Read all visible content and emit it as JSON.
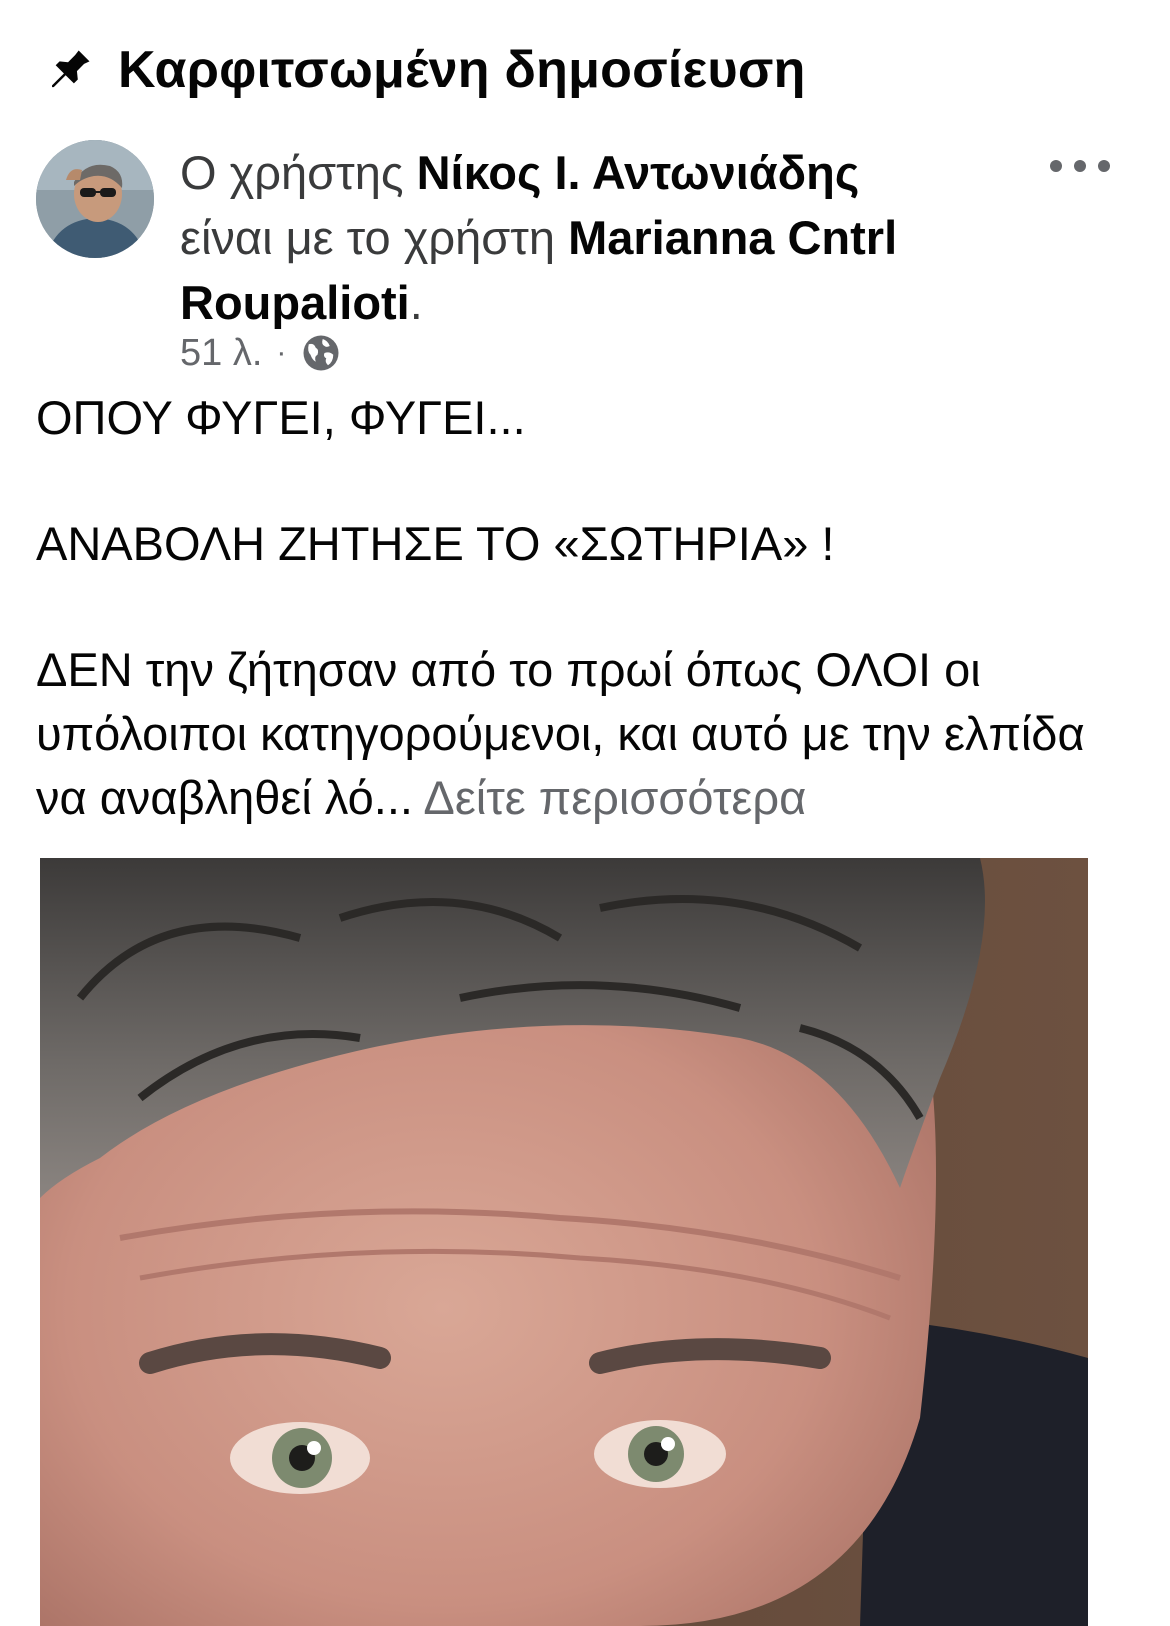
{
  "header": {
    "title": "Καρφιτσωμένη δημοσίευση",
    "icon": "pin-icon"
  },
  "post": {
    "author_prefix": "Ο χρήστης",
    "author_name": "Νίκος Ι. Αντωνιάδης",
    "with_text": "είναι με το χρήστη",
    "tagged_name": "Marianna Cntrl Roupalioti",
    "tagged_suffix": ".",
    "time": "51 λ.",
    "separator": "·",
    "privacy_icon": "globe-icon",
    "more_icon": "more-options-icon",
    "paragraphs": [
      "ΟΠΟΥ ΦΥΓΕΙ, ΦΥΓΕΙ...",
      "ΑΝΑΒΟΛΗ ΖΗΤΗΣΕ ΤΟ «ΣΩΤΗΡΙΑ» !"
    ],
    "last_paragraph": "ΔΕΝ την ζήτησαν από το πρωί όπως ΟΛΟΙ οι υπόλοιποι κατηγορούμενοι, και αυτό με την ελπίδα να αναβληθεί λό...",
    "see_more": "Δείτε περισσότερα"
  },
  "colors": {
    "text_primary": "#050505",
    "text_secondary": "#65676b",
    "background": "#ffffff"
  }
}
